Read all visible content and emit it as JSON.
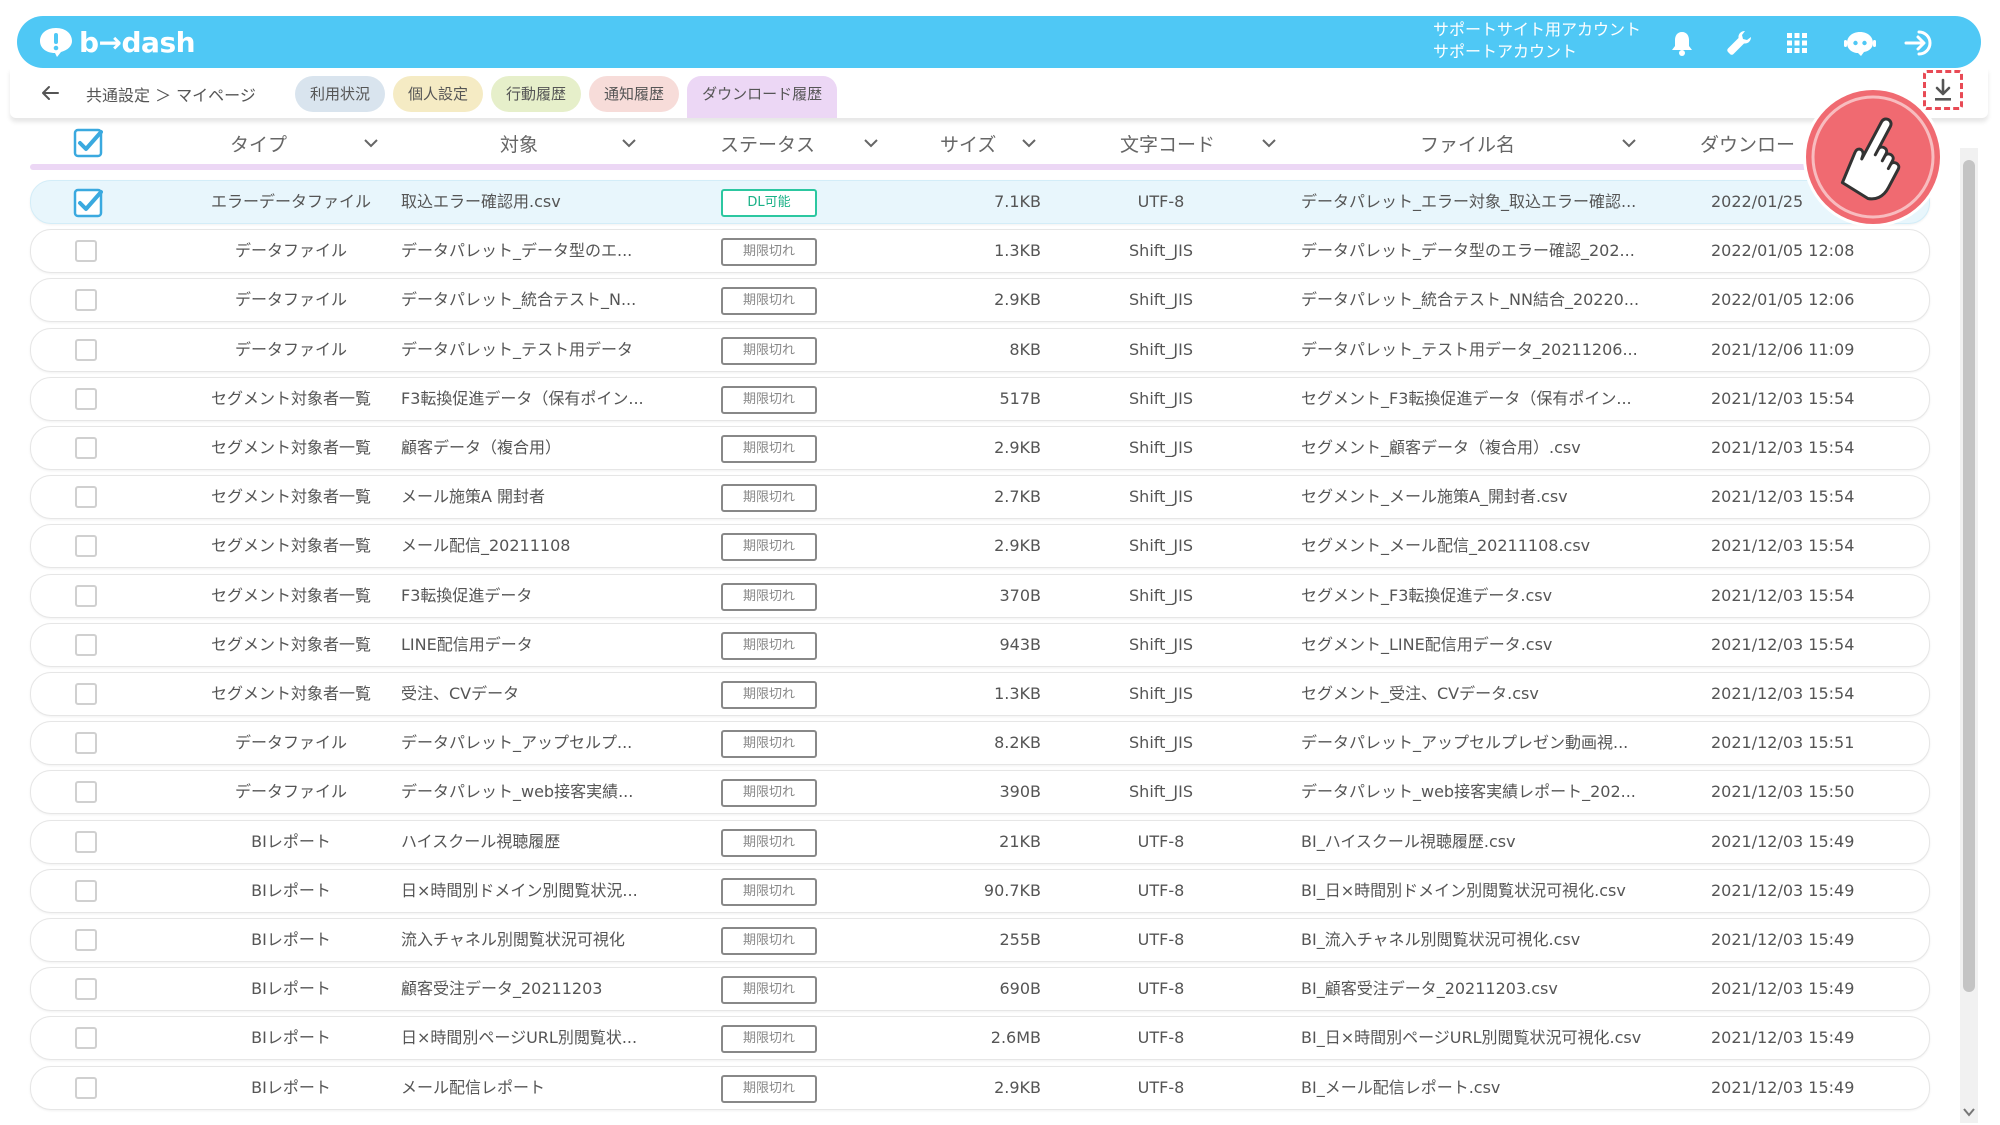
{
  "header": {
    "logo_text": "b→dash",
    "account_line1": "サポートサイト用アカウント",
    "account_line2": "サポートアカウント",
    "icons": [
      "bell-icon",
      "wrench-icon",
      "apps-grid-icon",
      "chat-bot-icon",
      "logout-icon"
    ]
  },
  "subbar": {
    "breadcrumb": "共通設定 ＞ マイページ",
    "tabs": [
      {
        "label": "利用状況",
        "color": "#d9e4ee"
      },
      {
        "label": "個人設定",
        "color": "#f5ebc4"
      },
      {
        "label": "行動履歴",
        "color": "#e6efca"
      },
      {
        "label": "通知履歴",
        "color": "#f7dcd9"
      },
      {
        "label": "ダウンロード履歴",
        "color": "#ecd7f5"
      }
    ],
    "active_tab": "ダウンロード履歴"
  },
  "table": {
    "columns": {
      "type": "タイプ",
      "target": "対象",
      "status": "ステータス",
      "size": "サイズ",
      "encoding": "文字コード",
      "filename": "ファイル名",
      "download": "ダウンロー"
    },
    "rows": [
      {
        "checked": true,
        "type": "エラーデータファイル",
        "target": "取込エラー確認用.csv",
        "status": "DL可能",
        "size": "7.1KB",
        "encoding": "UTF-8",
        "filename": "データパレット_エラー対象_取込エラー確認...",
        "date": "2022/01/25"
      },
      {
        "checked": false,
        "type": "データファイル",
        "target": "データパレット_データ型のエ...",
        "status": "期限切れ",
        "size": "1.3KB",
        "encoding": "Shift_JIS",
        "filename": "データパレット_データ型のエラー確認_202...",
        "date": "2022/01/05 12:08"
      },
      {
        "checked": false,
        "type": "データファイル",
        "target": "データパレット_統合テスト_N...",
        "status": "期限切れ",
        "size": "2.9KB",
        "encoding": "Shift_JIS",
        "filename": "データパレット_統合テスト_NN結合_20220...",
        "date": "2022/01/05 12:06"
      },
      {
        "checked": false,
        "type": "データファイル",
        "target": "データパレット_テスト用データ",
        "status": "期限切れ",
        "size": "8KB",
        "encoding": "Shift_JIS",
        "filename": "データパレット_テスト用データ_20211206...",
        "date": "2021/12/06 11:09"
      },
      {
        "checked": false,
        "type": "セグメント対象者一覧",
        "target": "F3転換促進データ（保有ポイン...",
        "status": "期限切れ",
        "size": "517B",
        "encoding": "Shift_JIS",
        "filename": "セグメント_F3転換促進データ（保有ポイン...",
        "date": "2021/12/03 15:54"
      },
      {
        "checked": false,
        "type": "セグメント対象者一覧",
        "target": "顧客データ（複合用）",
        "status": "期限切れ",
        "size": "2.9KB",
        "encoding": "Shift_JIS",
        "filename": "セグメント_顧客データ（複合用）.csv",
        "date": "2021/12/03 15:54"
      },
      {
        "checked": false,
        "type": "セグメント対象者一覧",
        "target": "メール施策A 開封者",
        "status": "期限切れ",
        "size": "2.7KB",
        "encoding": "Shift_JIS",
        "filename": "セグメント_メール施策A_開封者.csv",
        "date": "2021/12/03 15:54"
      },
      {
        "checked": false,
        "type": "セグメント対象者一覧",
        "target": "メール配信_20211108",
        "status": "期限切れ",
        "size": "2.9KB",
        "encoding": "Shift_JIS",
        "filename": "セグメント_メール配信_20211108.csv",
        "date": "2021/12/03 15:54"
      },
      {
        "checked": false,
        "type": "セグメント対象者一覧",
        "target": "F3転換促進データ",
        "status": "期限切れ",
        "size": "370B",
        "encoding": "Shift_JIS",
        "filename": "セグメント_F3転換促進データ.csv",
        "date": "2021/12/03 15:54"
      },
      {
        "checked": false,
        "type": "セグメント対象者一覧",
        "target": "LINE配信用データ",
        "status": "期限切れ",
        "size": "943B",
        "encoding": "Shift_JIS",
        "filename": "セグメント_LINE配信用データ.csv",
        "date": "2021/12/03 15:54"
      },
      {
        "checked": false,
        "type": "セグメント対象者一覧",
        "target": "受注、CVデータ",
        "status": "期限切れ",
        "size": "1.3KB",
        "encoding": "Shift_JIS",
        "filename": "セグメント_受注、CVデータ.csv",
        "date": "2021/12/03 15:54"
      },
      {
        "checked": false,
        "type": "データファイル",
        "target": "データパレット_アップセルプ...",
        "status": "期限切れ",
        "size": "8.2KB",
        "encoding": "Shift_JIS",
        "filename": "データパレット_アップセルプレゼン動画視...",
        "date": "2021/12/03 15:51"
      },
      {
        "checked": false,
        "type": "データファイル",
        "target": "データパレット_web接客実績...",
        "status": "期限切れ",
        "size": "390B",
        "encoding": "Shift_JIS",
        "filename": "データパレット_web接客実績レポート_202...",
        "date": "2021/12/03 15:50"
      },
      {
        "checked": false,
        "type": "BIレポート",
        "target": "ハイスクール視聴履歴",
        "status": "期限切れ",
        "size": "21KB",
        "encoding": "UTF-8",
        "filename": "BI_ハイスクール視聴履歴.csv",
        "date": "2021/12/03 15:49"
      },
      {
        "checked": false,
        "type": "BIレポート",
        "target": "日×時間別ドメイン別閲覧状況...",
        "status": "期限切れ",
        "size": "90.7KB",
        "encoding": "UTF-8",
        "filename": "BI_日×時間別ドメイン別閲覧状況可視化.csv",
        "date": "2021/12/03 15:49"
      },
      {
        "checked": false,
        "type": "BIレポート",
        "target": "流入チャネル別閲覧状況可視化",
        "status": "期限切れ",
        "size": "255B",
        "encoding": "UTF-8",
        "filename": "BI_流入チャネル別閲覧状況可視化.csv",
        "date": "2021/12/03 15:49"
      },
      {
        "checked": false,
        "type": "BIレポート",
        "target": "顧客受注データ_20211203",
        "status": "期限切れ",
        "size": "690B",
        "encoding": "UTF-8",
        "filename": "BI_顧客受注データ_20211203.csv",
        "date": "2021/12/03 15:49"
      },
      {
        "checked": false,
        "type": "BIレポート",
        "target": "日×時間別ページURL別閲覧状...",
        "status": "期限切れ",
        "size": "2.6MB",
        "encoding": "UTF-8",
        "filename": "BI_日×時間別ページURL別閲覧状況可視化.csv",
        "date": "2021/12/03 15:49"
      },
      {
        "checked": false,
        "type": "BIレポート",
        "target": "メール配信レポート",
        "status": "期限切れ",
        "size": "2.9KB",
        "encoding": "UTF-8",
        "filename": "BI_メール配信レポート.csv",
        "date": "2021/12/03 15:49"
      }
    ]
  },
  "colors": {
    "header": "#4fc8f5",
    "accent_check": "#3aa9df",
    "status_ok": "#2cc7a0",
    "highlight": "#e84a55"
  }
}
